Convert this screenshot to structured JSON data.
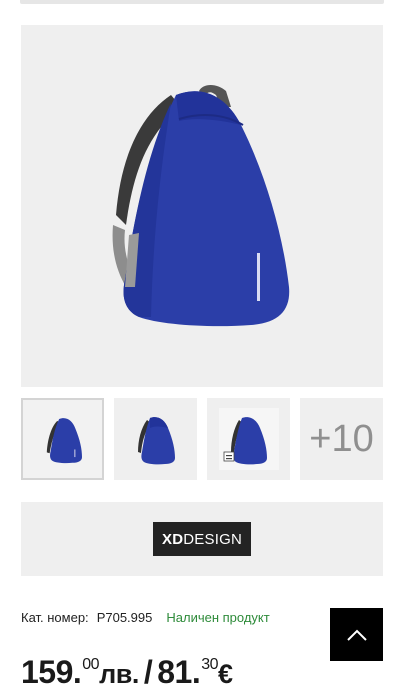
{
  "product": {
    "main_image_icon": "backpack-image",
    "thumbnails": [
      {
        "icon": "backpack-front-thumbnail",
        "active": true
      },
      {
        "icon": "backpack-side-thumbnail",
        "active": false
      },
      {
        "icon": "backpack-with-tag-thumbnail",
        "active": false
      }
    ],
    "more_thumbnails_label": "+10",
    "brand": {
      "logo_prefix": "XD",
      "logo_suffix": "DESIGN"
    },
    "sku_label": "Кат. номер:",
    "sku_value": "P705.995",
    "stock_status": "Наличен продукт",
    "price": {
      "bgn_whole": "159.",
      "bgn_cents": "00",
      "bgn_currency": "лв.",
      "separator": "/",
      "eur_whole": "81.",
      "eur_cents": "30",
      "eur_currency": "€"
    }
  },
  "scroll_top_icon": "chevron-up-icon",
  "colors": {
    "backpack_blue": "#2b3ea8",
    "stock_green": "#2e8b3a",
    "panel_gray": "#efefef",
    "logo_black": "#232323"
  }
}
